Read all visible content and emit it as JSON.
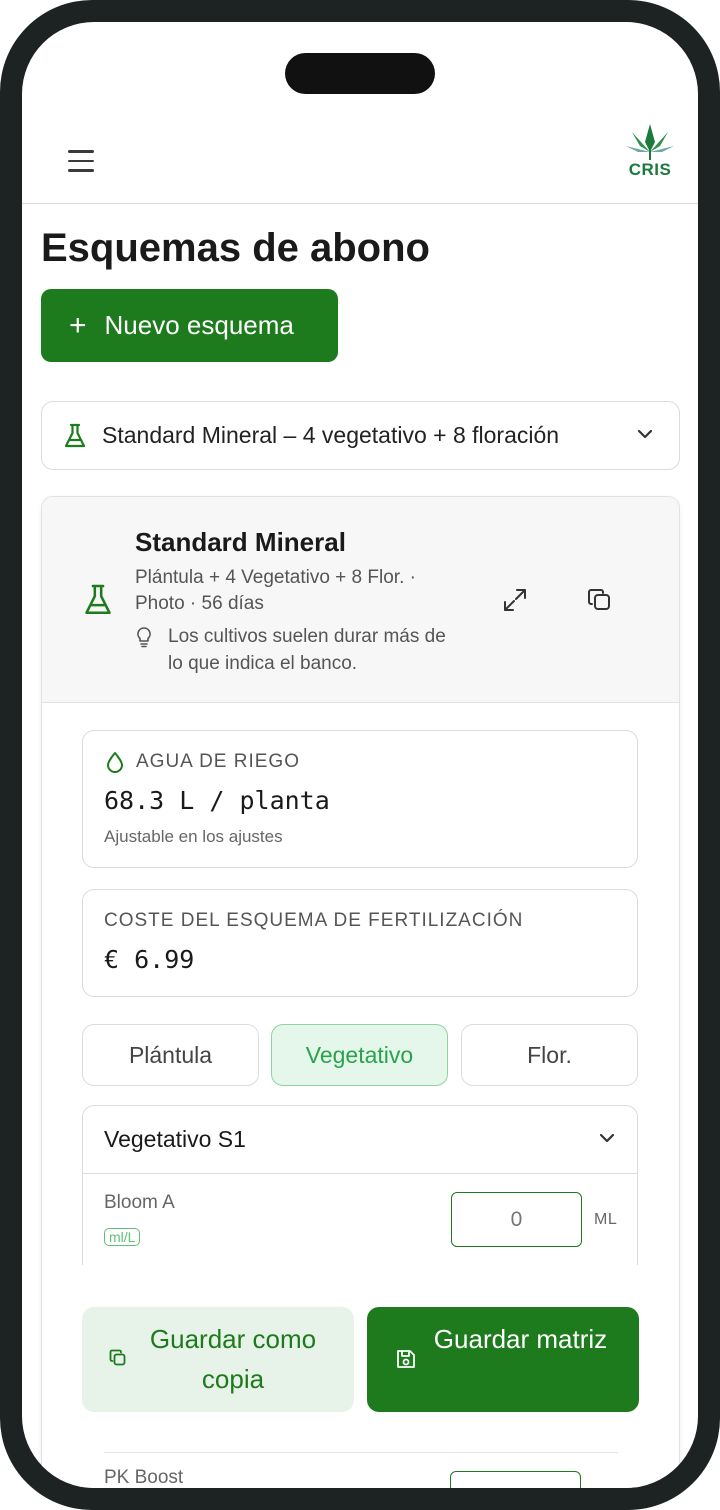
{
  "header": {
    "logo_text": "CRIS"
  },
  "page": {
    "title": "Esquemas de abono",
    "new_button": "Nuevo esquema"
  },
  "selector": {
    "value": "Standard Mineral – 4 vegetativo + 8 floración"
  },
  "scheme": {
    "name": "Standard Mineral",
    "subtitle": "Plántula + 4 Vegetativo + 8 Flor. · Photo · 56 días",
    "tip": "Los cultivos suelen durar más de lo que indica el banco."
  },
  "water": {
    "label": "AGUA DE RIEGO",
    "value": "68.3 L / planta",
    "note": "Ajustable en los ajustes"
  },
  "cost": {
    "label": "COSTE DEL ESQUEMA DE FERTILIZACIÓN",
    "value": "€ 6.99"
  },
  "phases": [
    {
      "label": "Plántula",
      "active": false
    },
    {
      "label": "Vegetativo",
      "active": true
    },
    {
      "label": "Flor.",
      "active": false
    }
  ],
  "stage": {
    "title": "Vegetativo S1",
    "fertilizer": {
      "name": "Bloom A",
      "unit_badge": "ml/L",
      "dose": "0",
      "dose_unit": "ML"
    }
  },
  "actions": {
    "save_copy": "Guardar como copia",
    "save_matrix": "Guardar matriz"
  },
  "next_fertilizer": {
    "name": "PK Boost"
  },
  "colors": {
    "brand_green": "#1d7b1d",
    "active_tab_bg": "#e4f7ea",
    "active_tab_text": "#2aa24e"
  }
}
